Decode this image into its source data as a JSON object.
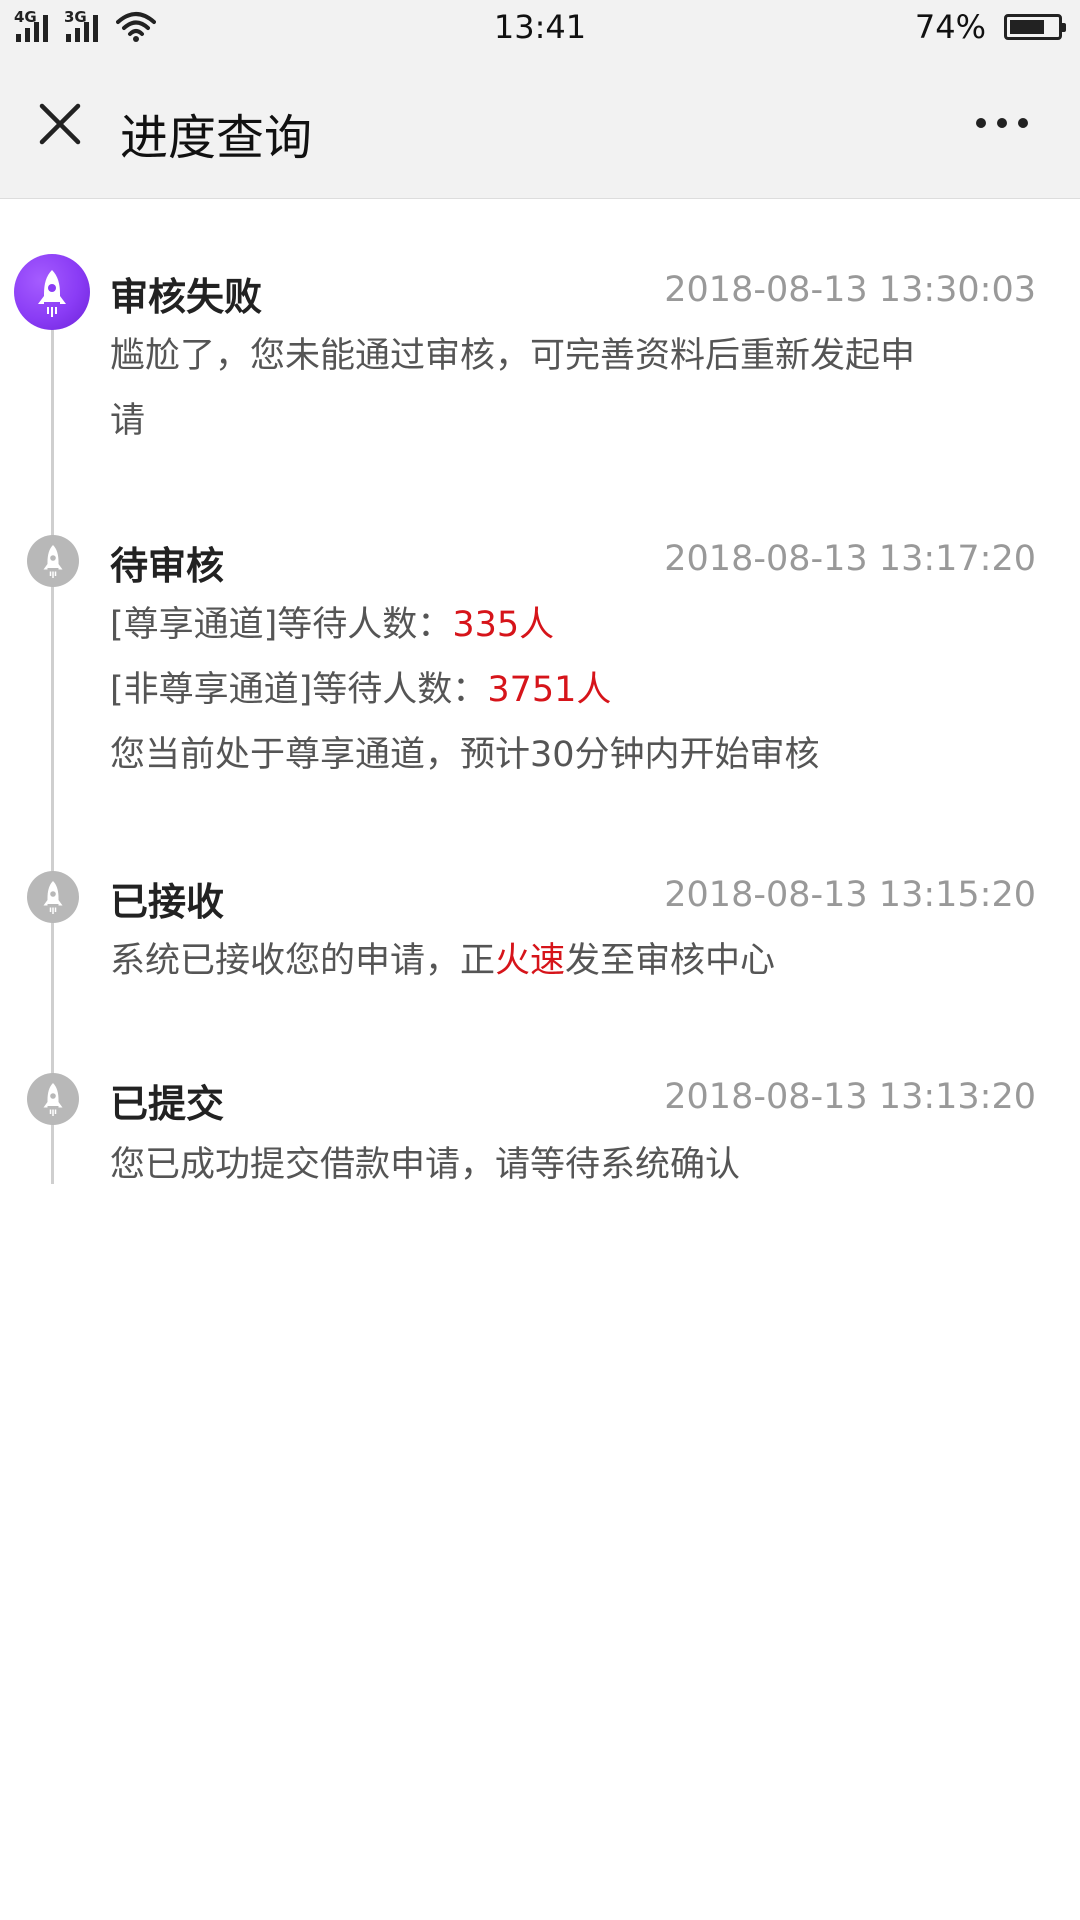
{
  "status_bar": {
    "network_1": "4G",
    "network_2": "3G",
    "time": "13:41",
    "battery_text": "74%",
    "battery_level": 0.74
  },
  "navbar": {
    "title": "进度查询",
    "close_icon": "close-icon",
    "more_icon": "more-icon"
  },
  "colors": {
    "highlight": "#d6141a",
    "active_icon": "#8a3cf5",
    "inactive_icon": "#b8b8b8",
    "timestamp": "#999999"
  },
  "steps": [
    {
      "title": "审核失败",
      "time": "2018-08-13 13:30:03",
      "icon": "rocket-icon",
      "active": true,
      "line1": "尴尬了，您未能通过审核，可完善资料后重新发起申",
      "line2": "请"
    },
    {
      "title": "待审核",
      "time": "2018-08-13 13:17:20",
      "icon": "rocket-icon",
      "active": false,
      "row1_prefix": "[尊享通道]等待人数：",
      "row1_value": "335人",
      "row2_prefix": "[非尊享通道]等待人数：",
      "row2_value": "3751人",
      "row3": "您当前处于尊享通道，预计30分钟内开始审核"
    },
    {
      "title": "已接收",
      "time": "2018-08-13 13:15:20",
      "icon": "rocket-icon",
      "active": false,
      "text_before": "系统已接收您的申请，正",
      "text_highlight": "火速",
      "text_after": "发至审核中心"
    },
    {
      "title": "已提交",
      "time": "2018-08-13 13:13:20",
      "icon": "rocket-icon",
      "active": false,
      "text": "您已成功提交借款申请，请等待系统确认"
    }
  ]
}
